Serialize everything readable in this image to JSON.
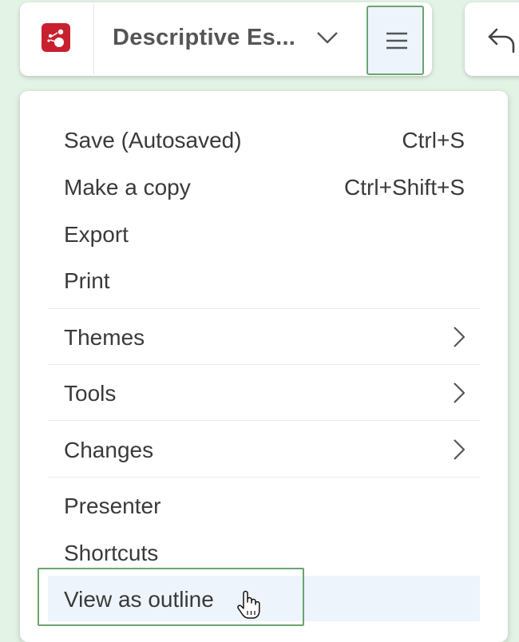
{
  "header": {
    "document_title": "Descriptive Es...",
    "logo_icon": "mindmap-app-logo",
    "dropdown_icon": "chevron-down-icon",
    "menu_icon": "hamburger-menu-icon",
    "undo_icon": "undo-icon"
  },
  "menu": {
    "items": [
      {
        "label": "Save (Autosaved)",
        "shortcut": "Ctrl+S"
      },
      {
        "label": "Make a copy",
        "shortcut": "Ctrl+Shift+S"
      },
      {
        "label": "Export"
      },
      {
        "label": "Print"
      },
      {
        "label": "Themes",
        "submenu": true
      },
      {
        "label": "Tools",
        "submenu": true
      },
      {
        "label": "Changes",
        "submenu": true
      },
      {
        "label": "Presenter"
      },
      {
        "label": "Shortcuts"
      },
      {
        "label": "View as outline",
        "highlighted": true
      }
    ]
  },
  "colors": {
    "background": "#e3f3e5",
    "highlight_border": "#6aa56f",
    "hover_bg": "#edf4fb",
    "logo_red": "#c8202f"
  }
}
